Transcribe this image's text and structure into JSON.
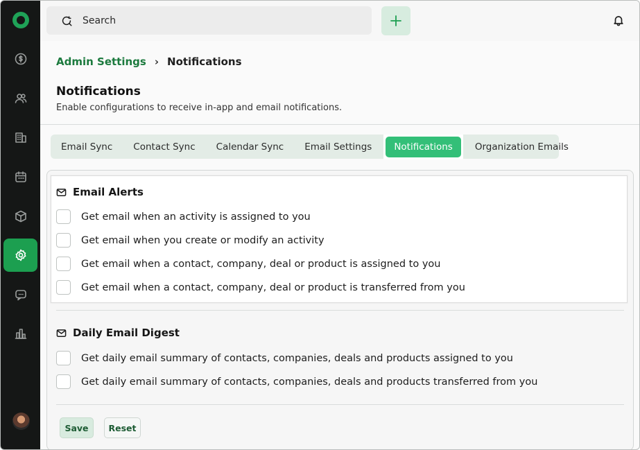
{
  "topbar": {
    "search_placeholder": "Search"
  },
  "breadcrumb": {
    "parent": "Admin Settings",
    "current": "Notifications"
  },
  "header": {
    "title": "Notifications",
    "subtitle": "Enable configurations to receive in-app and email notifications."
  },
  "tabs": [
    {
      "label": "Email Sync"
    },
    {
      "label": "Contact Sync"
    },
    {
      "label": "Calendar Sync"
    },
    {
      "label": "Email Settings"
    },
    {
      "label": "Notifications",
      "active": true
    },
    {
      "label": "Organization Emails"
    }
  ],
  "email_alerts": {
    "title": "Email Alerts",
    "items": [
      {
        "label": "Get email when an activity  is assigned to you",
        "checked": false
      },
      {
        "label": "Get email when you create or modify an activity",
        "checked": false
      },
      {
        "label": "Get email when a contact, company, deal or product is assigned to you",
        "checked": false
      },
      {
        "label": "Get email when a contact, company, deal or product is transferred from you",
        "checked": false
      }
    ]
  },
  "daily_digest": {
    "title": "Daily Email Digest",
    "items": [
      {
        "label": "Get daily email summary of contacts, companies, deals and products assigned to you",
        "checked": false
      },
      {
        "label": "Get daily email summary of contacts, companies, deals and products transferred from you",
        "checked": false
      }
    ]
  },
  "actions": {
    "save_label": "Save",
    "reset_label": "Reset"
  },
  "sidebar": {
    "icons": [
      "dollar-transfer-icon",
      "contacts-icon",
      "company-icon",
      "calendar-icon",
      "product-box-icon",
      "settings-icon",
      "chat-icon",
      "reports-icon"
    ],
    "active": "settings-icon"
  },
  "colors": {
    "brand_green": "#1c9f50",
    "active_tab": "#33bf78",
    "sidebar_bg": "#151716"
  }
}
